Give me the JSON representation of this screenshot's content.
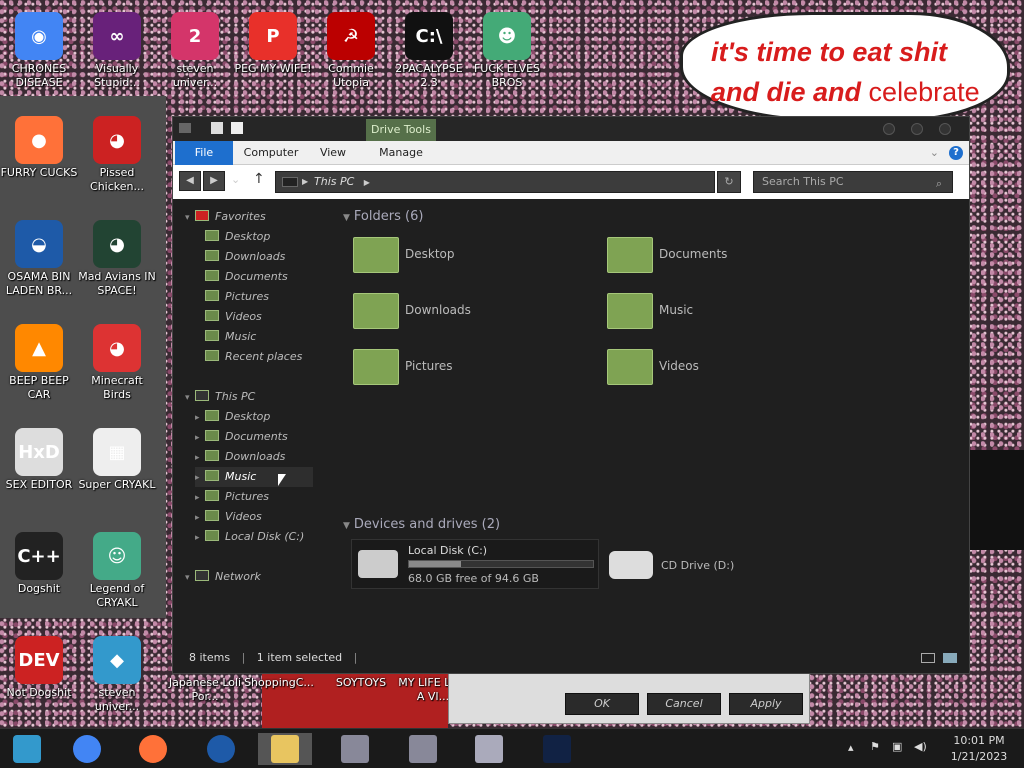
{
  "desktop": {
    "icons": [
      {
        "label": "CHRONES DISEASE",
        "color": "#4285f4",
        "glyph": "◉"
      },
      {
        "label": "Visually Stupid...",
        "color": "#68217a",
        "glyph": "∞"
      },
      {
        "label": "steven univer...",
        "color": "#d4356a",
        "glyph": "2"
      },
      {
        "label": "PEG MY WIFE!",
        "color": "#e8302a",
        "glyph": "P"
      },
      {
        "label": "Commie Utopia",
        "color": "#b00",
        "glyph": "☭"
      },
      {
        "label": "2PACALYPSE 2.3",
        "color": "#111",
        "glyph": "C:\\"
      },
      {
        "label": "FUCK ELVES BROS",
        "color": "#4a7",
        "glyph": "☻"
      },
      {
        "label": "FURRY CUCKS",
        "color": "#ff7139",
        "glyph": "●"
      },
      {
        "label": "Pissed Chicken...",
        "color": "#c22",
        "glyph": "◕"
      },
      {
        "label": "OSAMA BIN LADEN BR...",
        "color": "#1e5aa8",
        "glyph": "◒"
      },
      {
        "label": "Mad Avians IN SPACE!",
        "color": "#243",
        "glyph": "◕"
      },
      {
        "label": "BEEP BEEP CAR",
        "color": "#f80",
        "glyph": "▲"
      },
      {
        "label": "Minecraft Birds",
        "color": "#d33",
        "glyph": "◕"
      },
      {
        "label": "SEX EDITOR",
        "color": "#ddd",
        "glyph": "HxD"
      },
      {
        "label": "Super CRYAKL",
        "color": "#eee",
        "glyph": "▦"
      },
      {
        "label": "Dogshit",
        "color": "#222",
        "glyph": "C++"
      },
      {
        "label": "Legend of CRYAKL",
        "color": "#4a8",
        "glyph": "☺"
      },
      {
        "label": "Not Dogshit",
        "color": "#c22",
        "glyph": "DEV"
      },
      {
        "label": "steven univer...",
        "color": "#39c",
        "glyph": "◆"
      }
    ],
    "bottom_labels": [
      "Japanese Loli Por...",
      "ShoppingC...",
      "SOYTOYS",
      "MY LIFE LIKE A VI..."
    ],
    "speech_line1": "it's time to eat shit",
    "speech_line2": "and die and",
    "speech_line2b": "celebrate"
  },
  "explorer": {
    "context_tab": "Drive Tools",
    "ribbon_tabs": [
      "File",
      "Computer",
      "View",
      "Manage"
    ],
    "address": "This PC",
    "search_placeholder": "Search This PC",
    "nav_tree": [
      {
        "label": "Favorites",
        "level": 0,
        "icon": "heart"
      },
      {
        "label": "Desktop",
        "level": 1
      },
      {
        "label": "Downloads",
        "level": 1
      },
      {
        "label": "Documents",
        "level": 1
      },
      {
        "label": "Pictures",
        "level": 1
      },
      {
        "label": "Videos",
        "level": 1
      },
      {
        "label": "Music",
        "level": 1
      },
      {
        "label": "Recent places",
        "level": 1
      },
      {
        "label": "This PC",
        "level": 0
      },
      {
        "label": "Desktop",
        "level": 1
      },
      {
        "label": "Documents",
        "level": 1
      },
      {
        "label": "Downloads",
        "level": 1
      },
      {
        "label": "Music",
        "level": 1,
        "selected": true
      },
      {
        "label": "Pictures",
        "level": 1
      },
      {
        "label": "Videos",
        "level": 1
      },
      {
        "label": "Local Disk (C:)",
        "level": 1
      },
      {
        "label": "Network",
        "level": 0
      }
    ],
    "folders_header": "Folders (6)",
    "folders": [
      "Desktop",
      "Documents",
      "Downloads",
      "Music",
      "Pictures",
      "Videos"
    ],
    "devices_header": "Devices and drives (2)",
    "drive_c_name": "Local Disk (C:)",
    "drive_c_free": "68.0 GB free of 94.6 GB",
    "drive_c_used_fraction": 0.28,
    "drive_d_name": "CD Drive (D:)",
    "status_items": "8 items",
    "status_selected": "1 item selected"
  },
  "dialog": {
    "ok": "OK",
    "cancel": "Cancel",
    "apply": "Apply"
  },
  "taskbar": {
    "time": "10:01 PM",
    "date": "1/21/2023"
  }
}
